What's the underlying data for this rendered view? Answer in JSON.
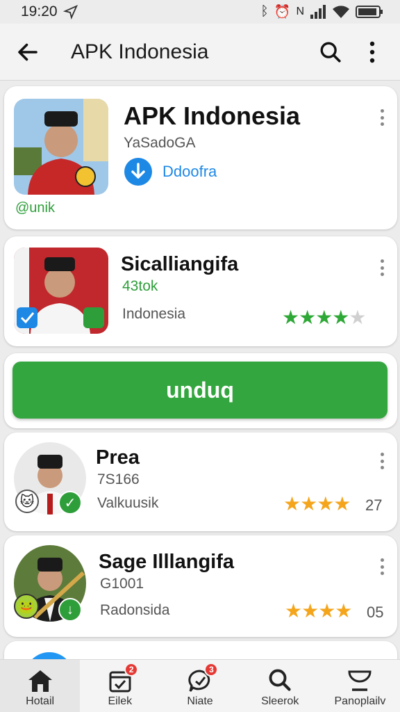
{
  "status_bar": {
    "time": "19:20",
    "right_icons": [
      "bluetooth-icon",
      "alarm-icon",
      "nfc-icon",
      "signal-icon",
      "wifi-icon",
      "battery-icon"
    ]
  },
  "app_bar": {
    "title": "APK Indonesia"
  },
  "cards": [
    {
      "title": "APK Indonesia",
      "developer": "YaSadoGA",
      "action_label": "Ddoofra",
      "badge_label": "@unik"
    },
    {
      "title": "Sicalliangifa",
      "meta": "43tok",
      "subtitle": "Indonesia",
      "rating": 4.5
    },
    {
      "title": "Prea",
      "meta": "7S166",
      "subtitle": "Valkuusik",
      "rating": 4,
      "rating_count": "27"
    },
    {
      "title": "Sage Illlangifa",
      "meta": "G1001",
      "subtitle": "Radonsida",
      "rating": 4,
      "rating_count": "05"
    }
  ],
  "download_button": {
    "label": "unduq"
  },
  "bottom_nav": [
    {
      "label": "Hotail",
      "icon": "home-icon",
      "active": true
    },
    {
      "label": "Eilek",
      "icon": "calendar-icon",
      "badge": "2"
    },
    {
      "label": "Niate",
      "icon": "chat-icon",
      "badge": "3"
    },
    {
      "label": "Sleerok",
      "icon": "search-icon"
    },
    {
      "label": "Panoplailv",
      "icon": "profile-icon"
    }
  ],
  "colors": {
    "primary_green": "#34a63f",
    "star_green": "#2ea836",
    "star_orange": "#f4a51c",
    "link_blue": "#1e88e5"
  }
}
